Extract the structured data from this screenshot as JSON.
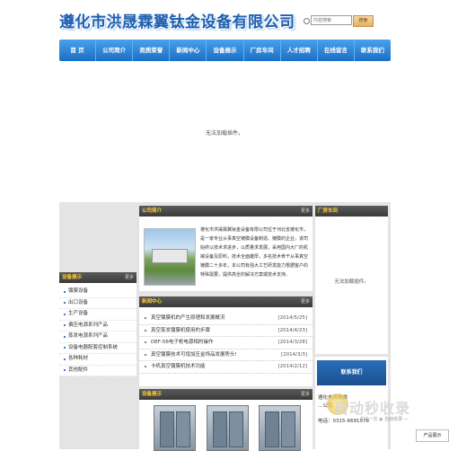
{
  "header": {
    "title": "遵化市洪晟霖翼钛金设备有限公司",
    "search_placeholder": "内容搜索",
    "search_button": "搜索"
  },
  "nav": {
    "items": [
      "首 页",
      "公司简介",
      "资质荣誉",
      "新闻中心",
      "设备展示",
      "厂房车间",
      "人才招聘",
      "在线留言",
      "联系我们"
    ]
  },
  "flash": {
    "message": "无法加载插件。"
  },
  "left": {
    "title": "设备展示",
    "more": "更多",
    "categories": [
      "镀膜设备",
      "出口设备",
      "生产设备",
      "偏压电源系列产品",
      "蒸发电源系列产品",
      "设备电器配套控制系统",
      "各种耗材",
      "其他配件"
    ]
  },
  "about": {
    "title": "公司简介",
    "more": "更多",
    "text": "遵化市洪晟霖翼钛金设备有限公司位于河北省遵化市，是一家专业从事真空镀膜设备制造、镀膜的企业，该司始终以技术求进步，以质量求发展，采用国内大厂的机械设备及原料，技术全面雄厚，多名技术骨干从事真空镀膜二十多年，本公司有强大工艺研发能力根据客户的特殊需要，提供高全的解决方案或技术支持。"
  },
  "news": {
    "title": "新闻中心",
    "more": "更多",
    "items": [
      {
        "title": "真空镀膜机的产生原理和发展概况",
        "date": "[2014/5/25]"
      },
      {
        "title": "真空蒸发镀膜机使用的步骤",
        "date": "[2014/4/23]"
      },
      {
        "title": "DEF-56电子枪电源相的操作",
        "date": "[2014/3/28]"
      },
      {
        "title": "真空镀膜技术可增加压金饰品发展势头!",
        "date": "[2014/3/3]"
      },
      {
        "title": "卡机真空镀膜机技术功能",
        "date": "[2014/2/12]"
      }
    ]
  },
  "products": {
    "title": "设备展示",
    "more": "更多"
  },
  "workshop": {
    "title": "厂房车间",
    "message": "无法加载插件。"
  },
  "contact": {
    "banner": "联系我们",
    "lines": [
      "遵化市洪晟霖",
      "…公司",
      "电话：0315-6691578"
    ]
  },
  "watermark": {
    "title": "自动秒收录",
    "subtitle": "— 关注一次 ◉ 自动收录 —",
    "badge": "产品展示"
  },
  "colors": {
    "nav_blue": "#1a6fc6",
    "title_blue": "#1f5fb0",
    "panel_dark": "#3a3a3a",
    "accent": "#ffcc33"
  }
}
